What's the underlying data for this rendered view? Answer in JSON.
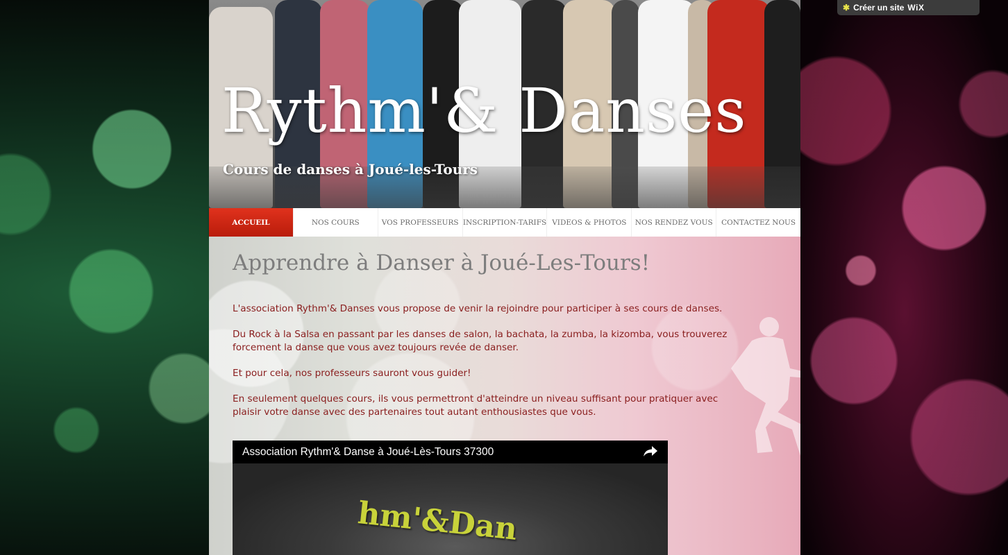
{
  "wix_banner": {
    "label": "Créer un site",
    "brand": "WiX",
    "icon": "wix-star-icon"
  },
  "header": {
    "title": "Rythm'& Danses",
    "subtitle": "Cours de danses à Joué-les-Tours"
  },
  "nav": {
    "items": [
      {
        "label": "ACCUEIL",
        "active": true
      },
      {
        "label": "NOS COURS"
      },
      {
        "label": "VOS PROFESSEURS"
      },
      {
        "label": "INSCRIPTION-TARIFS"
      },
      {
        "label": "VIDEOS & PHOTOS"
      },
      {
        "label": "NOS RENDEZ VOUS"
      },
      {
        "label": "CONTACTEZ NOUS"
      }
    ]
  },
  "main": {
    "title": "Apprendre à Danser à Joué-Les-Tours!",
    "paragraphs": [
      "L'association Rythm'& Danses vous propose de venir la rejoindre pour participer à ses cours de danses.",
      "Du Rock à la Salsa en passant par les danses de salon, la bachata, la zumba, la kizomba, vous trouverez forcement la danse que vous avez toujours revée de danser.",
      "Et pour cela, nos professeurs sauront vous guider!",
      "En seulement quelques cours, ils vous permettront d'atteindre un niveau suffisant pour pratiquer avec plaisir votre danse avec des partenaires tout autant enthousiastes que vous."
    ]
  },
  "video": {
    "title": "Association Rythm'& Danse à Joué-Lès-Tours 37300",
    "share_icon": "share-arrow-icon",
    "logo_text": "hm'&Dan"
  },
  "colors": {
    "accent_red": "#c62810",
    "text_red": "#8b2020",
    "nav_text": "#6a6a6a"
  }
}
